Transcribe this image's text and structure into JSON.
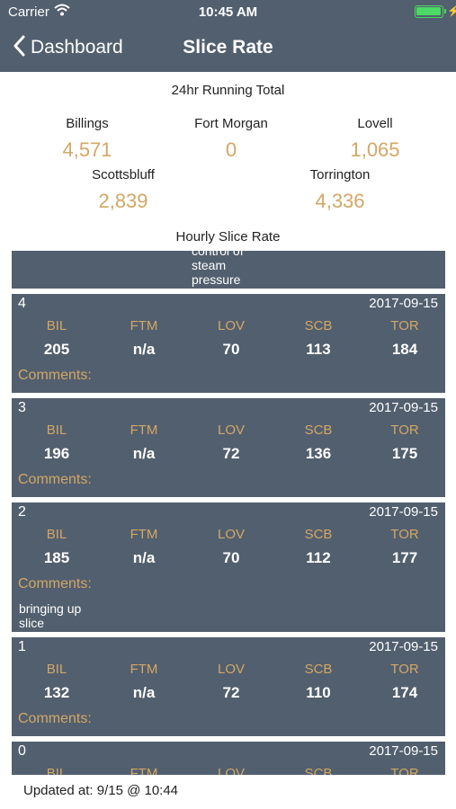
{
  "status_bar": {
    "carrier": "Carrier",
    "time": "10:45 AM"
  },
  "nav": {
    "back_label": "Dashboard",
    "title": "Slice Rate"
  },
  "totals": {
    "heading": "24hr Running Total",
    "locations": [
      {
        "name": "Billings",
        "value": "4,571"
      },
      {
        "name": "Fort Morgan",
        "value": "0"
      },
      {
        "name": "Lovell",
        "value": "1,065"
      },
      {
        "name": "Scottsbluff",
        "value": "2,839"
      },
      {
        "name": "Torrington",
        "value": "4,336"
      }
    ]
  },
  "hourly": {
    "heading": "Hourly Slice Rate",
    "partial_comment": "control of\nsteam\npressure",
    "columns": [
      "BIL",
      "FTM",
      "LOV",
      "SCB",
      "TOR"
    ],
    "comments_label": "Comments:",
    "entries": [
      {
        "hour": "4",
        "date": "2017-09-15",
        "values": [
          "205",
          "n/a",
          "70",
          "113",
          "184"
        ],
        "comment": ""
      },
      {
        "hour": "3",
        "date": "2017-09-15",
        "values": [
          "196",
          "n/a",
          "72",
          "136",
          "175"
        ],
        "comment": ""
      },
      {
        "hour": "2",
        "date": "2017-09-15",
        "values": [
          "185",
          "n/a",
          "70",
          "112",
          "177"
        ],
        "comment": "bringing up\nslice"
      },
      {
        "hour": "1",
        "date": "2017-09-15",
        "values": [
          "132",
          "n/a",
          "72",
          "110",
          "174"
        ],
        "comment": ""
      },
      {
        "hour": "0",
        "date": "2017-09-15",
        "values": [
          "",
          "",
          "",
          "",
          ""
        ],
        "comment": ""
      }
    ]
  },
  "footer": {
    "updated": "Updated at: 9/15 @ 10:44"
  },
  "colors": {
    "nav_bg": "#525f6e",
    "accent": "#d3a766",
    "battery": "#4cd964"
  }
}
